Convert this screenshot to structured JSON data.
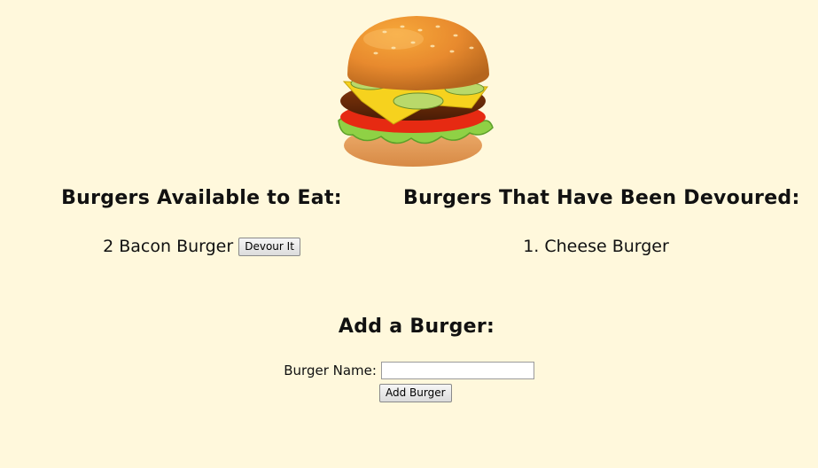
{
  "logo": {
    "icon": "burger-icon"
  },
  "available": {
    "title": "Burgers Available to Eat:",
    "items": [
      {
        "id": "2",
        "name": "Bacon Burger",
        "button_label": "Devour It"
      }
    ]
  },
  "devoured": {
    "title": "Burgers That Have Been Devoured:",
    "items": [
      {
        "id": "1.",
        "name": "Cheese Burger"
      }
    ]
  },
  "add_form": {
    "title": "Add a Burger:",
    "name_label": "Burger Name:",
    "name_value": "",
    "name_placeholder": "",
    "submit_label": "Add Burger"
  }
}
